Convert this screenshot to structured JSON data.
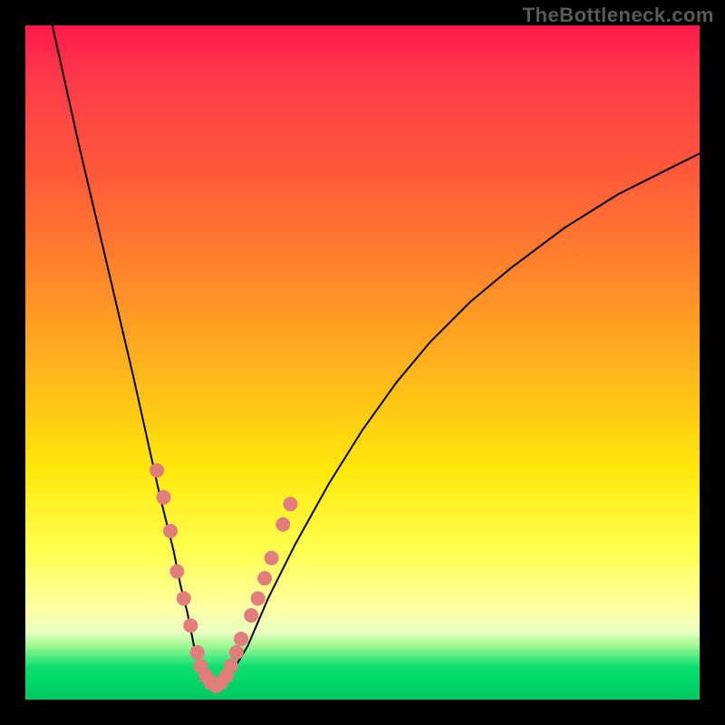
{
  "watermark": "TheBottleneck.com",
  "chart_data": {
    "type": "line",
    "title": "",
    "xlabel": "",
    "ylabel": "",
    "xlim": [
      0,
      100
    ],
    "ylim": [
      0,
      100
    ],
    "grid": false,
    "legend": false,
    "series": [
      {
        "name": "bottleneck-curve",
        "x": [
          4,
          8,
          12,
          16,
          18,
          20,
          22,
          23,
          24,
          25,
          26,
          27,
          28,
          30,
          33,
          36,
          40,
          45,
          50,
          55,
          60,
          66,
          72,
          80,
          88,
          96,
          100
        ],
        "y": [
          100,
          82,
          65,
          48,
          39,
          30,
          22,
          17,
          13,
          8,
          5,
          3,
          2,
          3,
          8,
          15,
          23,
          32,
          40,
          47,
          53,
          59,
          64,
          70,
          75,
          79,
          81
        ]
      }
    ],
    "scatter": {
      "name": "sample-points",
      "color": "#e27d7d",
      "points": [
        {
          "x": 19.5,
          "y": 34
        },
        {
          "x": 20.5,
          "y": 30
        },
        {
          "x": 21.5,
          "y": 25
        },
        {
          "x": 22.5,
          "y": 19
        },
        {
          "x": 23.5,
          "y": 15
        },
        {
          "x": 24.5,
          "y": 11
        },
        {
          "x": 25.5,
          "y": 7
        },
        {
          "x": 26.0,
          "y": 5
        },
        {
          "x": 26.8,
          "y": 3.5
        },
        {
          "x": 27.5,
          "y": 2.5
        },
        {
          "x": 28.3,
          "y": 2
        },
        {
          "x": 29.0,
          "y": 2.5
        },
        {
          "x": 29.8,
          "y": 3.5
        },
        {
          "x": 30.5,
          "y": 5
        },
        {
          "x": 31.3,
          "y": 7
        },
        {
          "x": 32.0,
          "y": 9
        },
        {
          "x": 33.5,
          "y": 12.5
        },
        {
          "x": 34.5,
          "y": 15
        },
        {
          "x": 35.5,
          "y": 18
        },
        {
          "x": 36.5,
          "y": 21
        },
        {
          "x": 38.2,
          "y": 26
        },
        {
          "x": 39.3,
          "y": 29
        }
      ]
    }
  }
}
